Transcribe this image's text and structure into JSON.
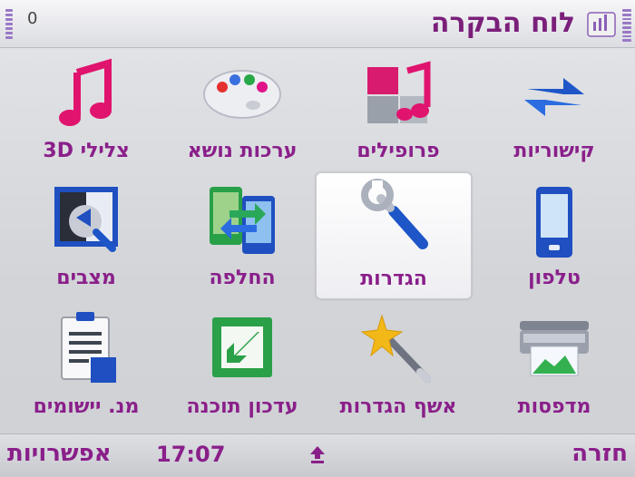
{
  "header": {
    "title": "לוח הבקרה",
    "mode": "0"
  },
  "apps": [
    {
      "label": "קישוריות",
      "icon": "connectivity-icon"
    },
    {
      "label": "פרופילים",
      "icon": "profiles-icon"
    },
    {
      "label": "ערכות נושא",
      "icon": "themes-icon"
    },
    {
      "label": "צלילי 3D",
      "icon": "3d-tones-icon"
    },
    {
      "label": "טלפון",
      "icon": "phone-icon"
    },
    {
      "label": "הגדרות",
      "icon": "settings-icon",
      "selected": true
    },
    {
      "label": "החלפה",
      "icon": "switch-icon"
    },
    {
      "label": "מצבים",
      "icon": "modes-icon"
    },
    {
      "label": "מדפסות",
      "icon": "printers-icon"
    },
    {
      "label": "אשף הגדרות",
      "icon": "settings-wizard-icon"
    },
    {
      "label": "עדכון תוכנה",
      "icon": "software-update-icon"
    },
    {
      "label": "מנ. יישומים",
      "icon": "app-manager-icon"
    }
  ],
  "footer": {
    "left_softkey": "אפשרויות",
    "clock": "17:07",
    "right_softkey": "חזרה"
  }
}
